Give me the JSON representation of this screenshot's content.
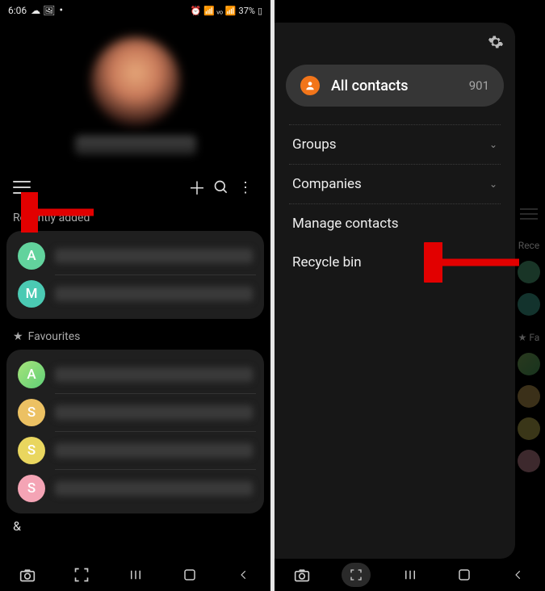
{
  "status": {
    "time": "6:06",
    "battery": "37%",
    "indicators_left": "⛅ 🖼",
    "indicators_right": "⏰ 📶 VoLTE 📶"
  },
  "left": {
    "sections": {
      "recently": "Recently added",
      "favourites": "Favourites"
    },
    "recent": [
      {
        "letter": "A",
        "color": "c-green"
      },
      {
        "letter": "M",
        "color": "c-teal"
      }
    ],
    "favourites": [
      {
        "letter": "A",
        "color": "c-green2"
      },
      {
        "letter": "S",
        "color": "c-orange"
      },
      {
        "letter": "S",
        "color": "c-yellow"
      },
      {
        "letter": "S",
        "color": "c-pink"
      }
    ],
    "index_letter": "&"
  },
  "right": {
    "drawer": {
      "all_contacts": "All contacts",
      "count": "901",
      "groups": "Groups",
      "companies": "Companies",
      "manage": "Manage contacts",
      "recycle": "Recycle bin"
    },
    "peek": {
      "rece": "Rece",
      "fa": "Fa"
    }
  }
}
